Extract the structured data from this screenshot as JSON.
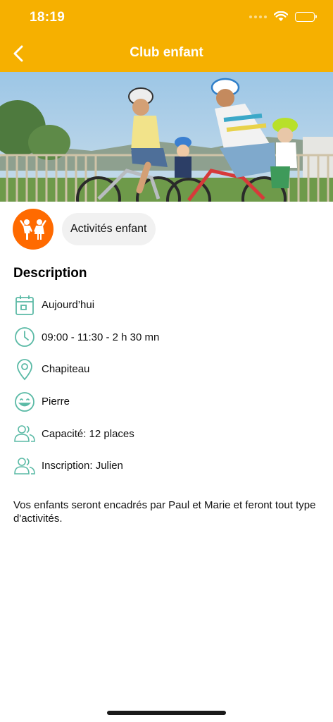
{
  "status_bar": {
    "time": "18:19",
    "icons": [
      "signal-icon",
      "wifi-icon",
      "battery-icon"
    ]
  },
  "nav": {
    "title": "Club enfant",
    "back_icon": "chevron-left-icon"
  },
  "hero_image": {
    "alt": ""
  },
  "category": {
    "icon": "children-icon",
    "label": "Activités enfant",
    "icon_color": "#FF6A00"
  },
  "section": {
    "title": "Description"
  },
  "details": [
    {
      "icon": "calendar-icon",
      "text": "Aujourd’hui"
    },
    {
      "icon": "clock-icon",
      "text": "09:00 - 11:30 - 2 h 30 mn"
    },
    {
      "icon": "location-pin-icon",
      "text": "Chapiteau"
    },
    {
      "icon": "smiley-icon",
      "text": "Pierre"
    },
    {
      "icon": "people-icon",
      "text": "Capacité: 12 places"
    },
    {
      "icon": "people-icon",
      "text": "Inscription: Julien"
    }
  ],
  "description": "Vos enfants seront encadrés par Paul et Marie et feront tout type d'activités.",
  "colors": {
    "header": "#F6B000",
    "accent_icon": "#5BBAA6",
    "category": "#FF6A00",
    "chip_bg": "#F1F1F1"
  }
}
